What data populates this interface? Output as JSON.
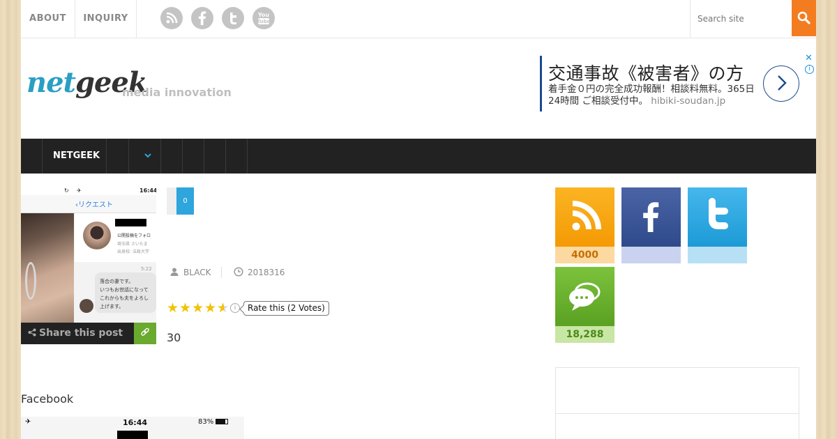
{
  "topnav": {
    "items": [
      "ABOUT",
      "INQUIRY"
    ],
    "social_icons": [
      "rss-icon",
      "facebook-icon",
      "twitter-icon",
      "youtube-icon"
    ],
    "search_placeholder": "Search site"
  },
  "header": {
    "logo_part1": "net",
    "logo_part2": "geek",
    "tagline": "media innovation"
  },
  "ad": {
    "title": "交通事故《被害者》の方",
    "desc": "着手金０円の完全成功報酬！相談料無料。365日24時間 ご相談受付中。",
    "url": "hibiki-soudan.jp",
    "close": "✕",
    "info": "i"
  },
  "mainnav": {
    "label": "NETGEEK",
    "chevron": "⌄"
  },
  "article": {
    "share_label": "Share this post",
    "count": "0",
    "author": "BLACK",
    "date": "2018316",
    "rate_text": "Rate this (2 Votes)",
    "rating": 4.5,
    "body_number": "30",
    "section_label": "Facebook",
    "thumb_screen": {
      "status_time": "16:44",
      "back_label": "リクエスト",
      "card_lines": [
        "公開投稿をフォロ",
        "埼玉県 さいたま",
        "出身校: 法政大学"
      ],
      "message_time": "5:22",
      "bubble_lines": [
        "落合の妻です。",
        "いつもお世話になって",
        "これからも夫をよろし",
        "上げます。"
      ]
    },
    "thumb2": {
      "time": "16:44",
      "battery": "83%"
    }
  },
  "sidebar": {
    "tiles": [
      {
        "name": "rss",
        "count": "4000",
        "color": "#f6a20b",
        "light": "#fbd9a0",
        "text_color": "#c76e00"
      },
      {
        "name": "facebook",
        "count": "",
        "color": "#3a5597",
        "light": "#c9d3f0",
        "text_color": "#3a5597"
      },
      {
        "name": "twitter",
        "count": "",
        "color": "#2fa8e2",
        "light": "#b7e0f5",
        "text_color": "#2fa8e2"
      },
      {
        "name": "comments",
        "count": "18,288",
        "color": "#6db12f",
        "light": "#c8e6a4",
        "text_color": "#4a8a17"
      }
    ]
  },
  "colors": {
    "accent_orange": "#f47c20",
    "accent_blue": "#2ea5dc",
    "nav_dark": "#222222",
    "star": "#f2c200"
  }
}
